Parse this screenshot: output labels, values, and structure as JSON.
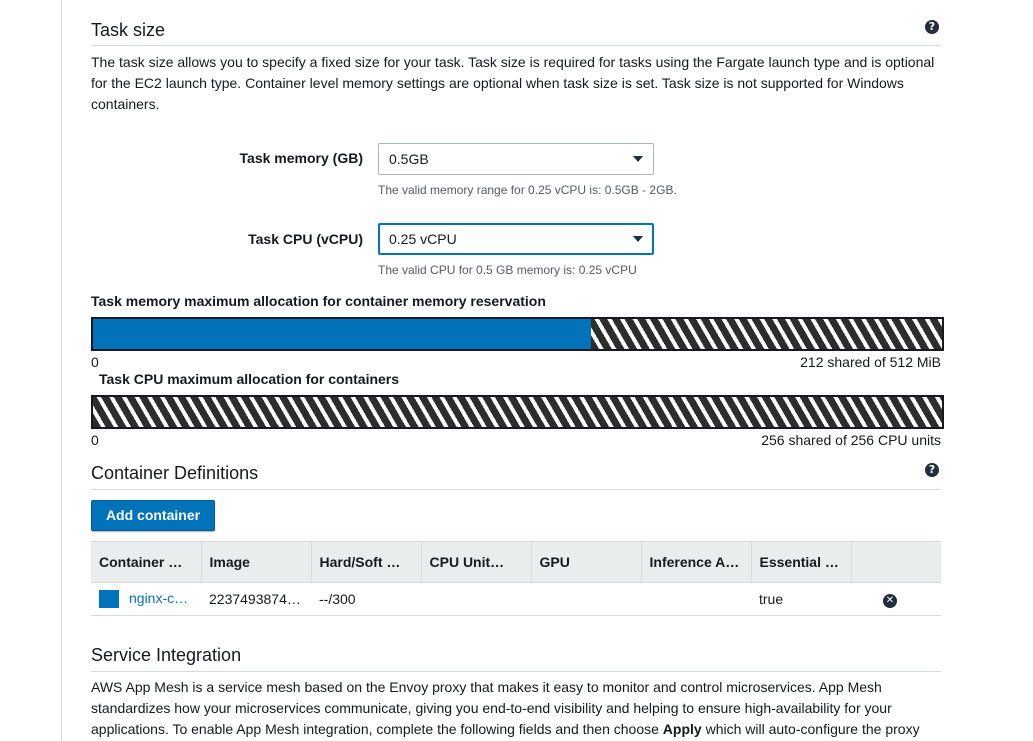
{
  "task_size": {
    "title": "Task size",
    "help_icon": "question-circle-icon",
    "description": "The task size allows you to specify a fixed size for your task. Task size is required for tasks using the Fargate launch type and is optional for the EC2 launch type. Container level memory settings are optional when task size is set. Task size is not supported for Windows containers.",
    "memory": {
      "label": "Task memory (GB)",
      "value": "0.5GB",
      "hint": "The valid memory range for 0.25 vCPU is: 0.5GB - 2GB."
    },
    "cpu": {
      "label": "Task CPU (vCPU)",
      "value": "0.25 vCPU",
      "hint": "The valid CPU for 0.5 GB memory is: 0.25 vCPU"
    }
  },
  "memory_allocation": {
    "label": "Task memory maximum allocation for container memory reservation",
    "axis_start": "0",
    "summary": "212 shared of 512 MiB",
    "reserved_fraction": 0.586
  },
  "cpu_allocation": {
    "label": "Task CPU maximum allocation for containers",
    "axis_start": "0",
    "summary": "256 shared of 256 CPU units",
    "reserved_fraction": 0
  },
  "container_definitions": {
    "title": "Container Definitions",
    "help_icon": "question-circle-icon",
    "add_button": "Add container",
    "columns": [
      "Container …",
      "Image",
      "Hard/Soft …",
      "CPU Unit…",
      "GPU",
      "Inference A…",
      "Essential …",
      ""
    ],
    "rows": [
      {
        "name": "nginx-c…",
        "image": "2237493874…",
        "hard_soft": "--/300",
        "cpu_units": "",
        "gpu": "",
        "inference": "",
        "essential": "true",
        "remove_icon": "remove-circle-icon"
      }
    ]
  },
  "service_integration": {
    "title": "Service Integration",
    "description_1": "AWS App Mesh is a service mesh based on the Envoy proxy that makes it easy to monitor and control microservices. App Mesh standardizes how your microservices communicate, giving you end-to-end visibility and helping to ensure high-availability for your applications. To enable App Mesh integration, complete the following fields and then choose ",
    "description_bold": "Apply",
    "description_2": " which will auto-configure the proxy"
  },
  "colors": {
    "accent": "#0073bb",
    "stripe_dark": "#2d2d2d"
  }
}
